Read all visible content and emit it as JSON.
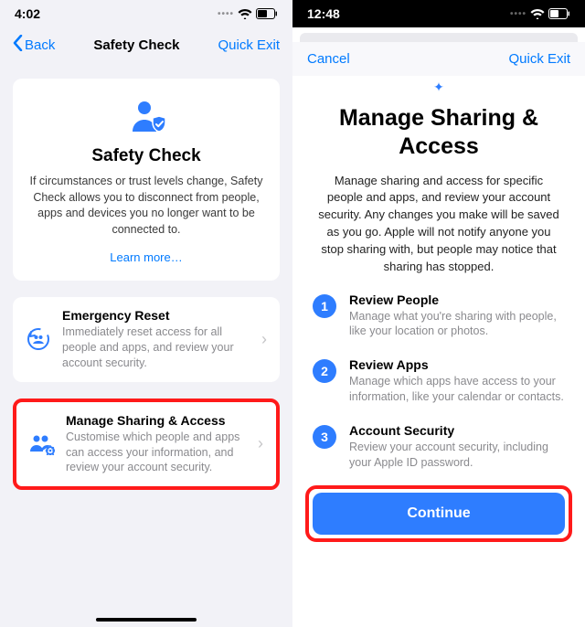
{
  "left": {
    "status_time": "4:02",
    "nav": {
      "back": "Back",
      "title": "Safety Check",
      "quick_exit": "Quick Exit"
    },
    "card": {
      "title": "Safety Check",
      "body": "If circumstances or trust levels change, Safety Check allows you to disconnect from people, apps and devices you no longer want to be connected to.",
      "learn_more": "Learn more…"
    },
    "emergency": {
      "title": "Emergency Reset",
      "sub": "Immediately reset access for all people and apps, and review your account security."
    },
    "manage": {
      "title": "Manage Sharing & Access",
      "sub": "Customise which people and apps can access your information, and review your account security."
    }
  },
  "right": {
    "status_time": "12:48",
    "nav": {
      "cancel": "Cancel",
      "quick_exit": "Quick Exit"
    },
    "title": "Manage Sharing & Access",
    "body": "Manage sharing and access for specific people and apps, and review your account security. Any changes you make will be saved as you go. Apple will not notify anyone you stop sharing with, but people may notice that sharing has stopped.",
    "steps": [
      {
        "num": "1",
        "title": "Review People",
        "sub": "Manage what you're sharing with people, like your location or photos."
      },
      {
        "num": "2",
        "title": "Review Apps",
        "sub": "Manage which apps have access to your information, like your calendar or contacts."
      },
      {
        "num": "3",
        "title": "Account Security",
        "sub": "Review your account security, including your Apple ID password."
      }
    ],
    "continue": "Continue"
  }
}
